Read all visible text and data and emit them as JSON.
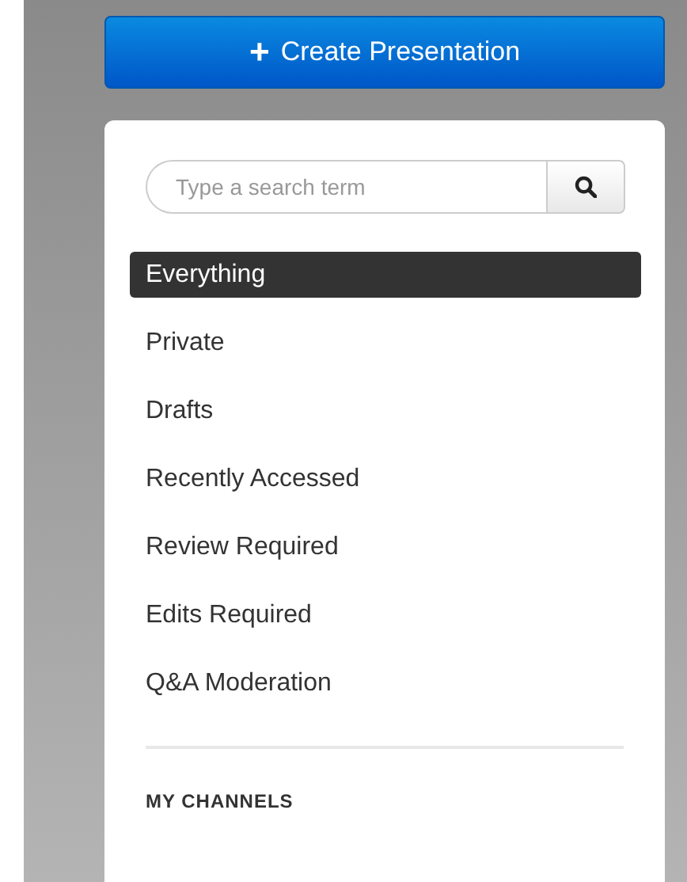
{
  "create_button": {
    "icon": "+",
    "label": "Create Presentation"
  },
  "search": {
    "placeholder": "Type a search term"
  },
  "nav_items": [
    {
      "label": "Everything",
      "selected": true
    },
    {
      "label": "Private",
      "selected": false
    },
    {
      "label": "Drafts",
      "selected": false
    },
    {
      "label": "Recently Accessed",
      "selected": false
    },
    {
      "label": "Review Required",
      "selected": false
    },
    {
      "label": "Edits Required",
      "selected": false
    },
    {
      "label": "Q&A Moderation",
      "selected": false
    }
  ],
  "section_heading": "MY CHANNELS"
}
